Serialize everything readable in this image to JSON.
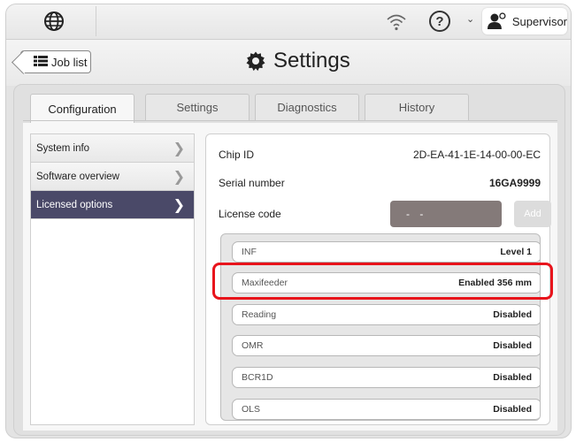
{
  "topbar": {
    "user_label": "Supervisor"
  },
  "header": {
    "job_list_label": "Job list",
    "title": "Settings"
  },
  "tabs": [
    {
      "label": "Configuration"
    },
    {
      "label": "Settings"
    },
    {
      "label": "Diagnostics"
    },
    {
      "label": "History"
    }
  ],
  "menu": {
    "items": [
      {
        "label": "System info"
      },
      {
        "label": "Software overview"
      },
      {
        "label": "Licensed options"
      }
    ]
  },
  "info": {
    "chip_id_label": "Chip ID",
    "chip_id_value": "2D-EA-41-1E-14-00-00-EC",
    "serial_label": "Serial number",
    "serial_value": "16GA9999",
    "license_label": "License code",
    "license_value": "- -",
    "add_label": "Add"
  },
  "options": [
    {
      "name": "INF",
      "value": "Level 1"
    },
    {
      "name": "Maxifeeder",
      "value": "Enabled 356 mm"
    },
    {
      "name": "Reading",
      "value": "Disabled"
    },
    {
      "name": "OMR",
      "value": "Disabled"
    },
    {
      "name": "BCR1D",
      "value": "Disabled"
    },
    {
      "name": "OLS",
      "value": "Disabled"
    }
  ],
  "colors": {
    "active_menu": "#4a4968",
    "highlight": "#e8141c",
    "license_field": "#847a79"
  }
}
